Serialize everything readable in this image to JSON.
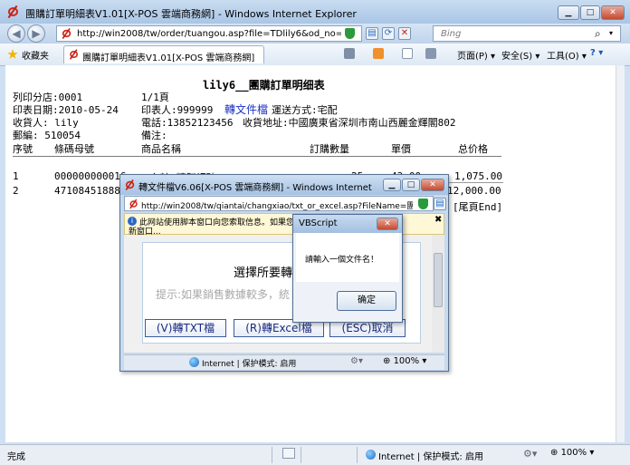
{
  "window": {
    "title": "團購訂單明細表V1.01[X-POS 雲端商務網] - Windows Internet Explorer",
    "minimize": "▁",
    "maximize": "□",
    "close": "✕"
  },
  "address": {
    "url": "http://win2008/tw/order/tuangou.asp?file=TDlily6&od_no=000044",
    "search_placeholder": "Bing",
    "back": "◀",
    "forward": "▶"
  },
  "commandbar": {
    "favorites": "收藏夹",
    "tab_title": "團購訂單明細表V1.01[X-POS 雲端商務網]",
    "page_menu": "页面(P) ▾",
    "safety_menu": "安全(S) ▾",
    "tools_menu": "工具(O) ▾",
    "help": "? ▾"
  },
  "report": {
    "title": "lily6__團購訂單明细表",
    "branch": "列印分店:0001",
    "page": "1/1頁",
    "print_date": "印表日期:2010-05-24",
    "printer": "印表人:999999",
    "convert_link": "轉文件檔",
    "ship_method": "運送方式:宅配",
    "recipient": "收貨人: lily",
    "phone": "電話:13852123456",
    "address": "收貨地址:中國廣東省深圳市南山西麗金輝閣802",
    "postcode": "郵編: 510054",
    "remark": "備注:",
    "headers": [
      "序號",
      "條碼母號",
      "商品名稱",
      "訂購數量",
      "單價",
      "总价格"
    ],
    "rows": [
      {
        "no": "1",
        "barcode": "000000000016",
        "name": "台糖-精製細砂2Kg",
        "qty": "25",
        "price": "43.00",
        "total": "1,075.00"
      },
      {
        "no": "2",
        "barcode": "471084518888",
        "name": "",
        "qty": "",
        "price": "",
        "total": "12,000.00"
      }
    ],
    "end_mark": "[尾頁End]"
  },
  "dialog": {
    "title": "轉文件檔V6.06[X-POS 雲端商務網] - Windows Internet Explorer",
    "url": "http://win2008/tw/qiantai/changxiao/txt_or_excel.asp?FileName=團購訂",
    "info_text": "此网站使用脚本窗口向您索取信息。如果您",
    "info_text_tail": "新窗口...",
    "info_close": "✖",
    "select_label": "選擇所要轉檔",
    "hint": "提示:如果銷售數據較多，統",
    "btn_txt": "(V)轉TXT檔",
    "btn_excel": "(R)轉Excel檔",
    "btn_cancel": "(ESC)取消",
    "status_zone": "Internet | 保护模式: 启用",
    "zoom": "100%"
  },
  "msgbox": {
    "title": "VBScript",
    "message": "請輸入一個文件名！",
    "ok": "确定",
    "close": "✕"
  },
  "statusbar": {
    "status": "完成",
    "zone": "Internet | 保护模式: 启用",
    "zoom": "100%"
  }
}
